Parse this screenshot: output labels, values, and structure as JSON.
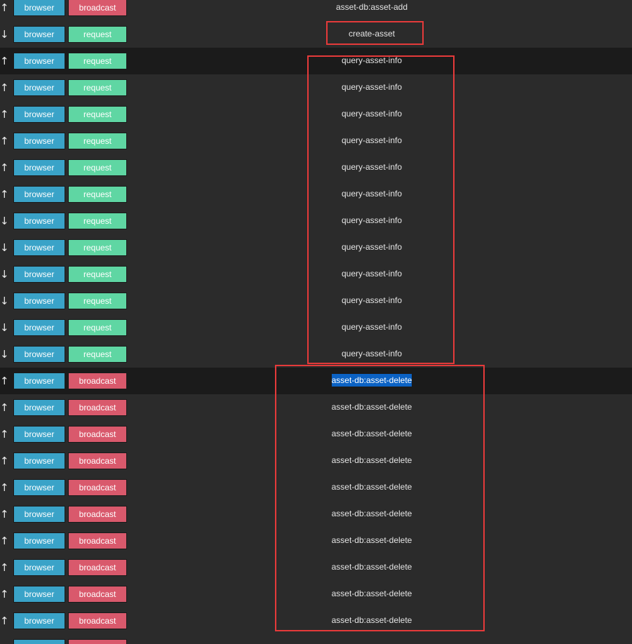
{
  "rows": [
    {
      "dir": "↑",
      "source": "browser",
      "kind": "broadcast",
      "message": "asset-db:asset-add"
    },
    {
      "dir": "↓",
      "source": "browser",
      "kind": "request",
      "message": "create-asset"
    },
    {
      "dir": "↑",
      "source": "browser",
      "kind": "request",
      "message": "query-asset-info"
    },
    {
      "dir": "↑",
      "source": "browser",
      "kind": "request",
      "message": "query-asset-info"
    },
    {
      "dir": "↑",
      "source": "browser",
      "kind": "request",
      "message": "query-asset-info"
    },
    {
      "dir": "↑",
      "source": "browser",
      "kind": "request",
      "message": "query-asset-info"
    },
    {
      "dir": "↑",
      "source": "browser",
      "kind": "request",
      "message": "query-asset-info"
    },
    {
      "dir": "↑",
      "source": "browser",
      "kind": "request",
      "message": "query-asset-info"
    },
    {
      "dir": "↓",
      "source": "browser",
      "kind": "request",
      "message": "query-asset-info"
    },
    {
      "dir": "↓",
      "source": "browser",
      "kind": "request",
      "message": "query-asset-info"
    },
    {
      "dir": "↓",
      "source": "browser",
      "kind": "request",
      "message": "query-asset-info"
    },
    {
      "dir": "↓",
      "source": "browser",
      "kind": "request",
      "message": "query-asset-info"
    },
    {
      "dir": "↓",
      "source": "browser",
      "kind": "request",
      "message": "query-asset-info"
    },
    {
      "dir": "↓",
      "source": "browser",
      "kind": "request",
      "message": "query-asset-info"
    },
    {
      "dir": "↑",
      "source": "browser",
      "kind": "broadcast",
      "message": "asset-db:asset-delete",
      "selected": true
    },
    {
      "dir": "↑",
      "source": "browser",
      "kind": "broadcast",
      "message": "asset-db:asset-delete"
    },
    {
      "dir": "↑",
      "source": "browser",
      "kind": "broadcast",
      "message": "asset-db:asset-delete"
    },
    {
      "dir": "↑",
      "source": "browser",
      "kind": "broadcast",
      "message": "asset-db:asset-delete"
    },
    {
      "dir": "↑",
      "source": "browser",
      "kind": "broadcast",
      "message": "asset-db:asset-delete"
    },
    {
      "dir": "↑",
      "source": "browser",
      "kind": "broadcast",
      "message": "asset-db:asset-delete"
    },
    {
      "dir": "↑",
      "source": "browser",
      "kind": "broadcast",
      "message": "asset-db:asset-delete"
    },
    {
      "dir": "↑",
      "source": "browser",
      "kind": "broadcast",
      "message": "asset-db:asset-delete"
    },
    {
      "dir": "↑",
      "source": "browser",
      "kind": "broadcast",
      "message": "asset-db:asset-delete"
    },
    {
      "dir": "↑",
      "source": "browser",
      "kind": "broadcast",
      "message": "asset-db:asset-delete"
    },
    {
      "dir": "",
      "source": "browser",
      "kind": "broadcast",
      "message": ""
    }
  ],
  "highlighted_rows": [
    2,
    14
  ],
  "colors": {
    "source_tag": "#3aa3c8",
    "broadcast_tag": "#d9596c",
    "request_tag": "#5fd6a3",
    "annotation_box": "#e53a3a",
    "selection": "#0b62c4"
  }
}
